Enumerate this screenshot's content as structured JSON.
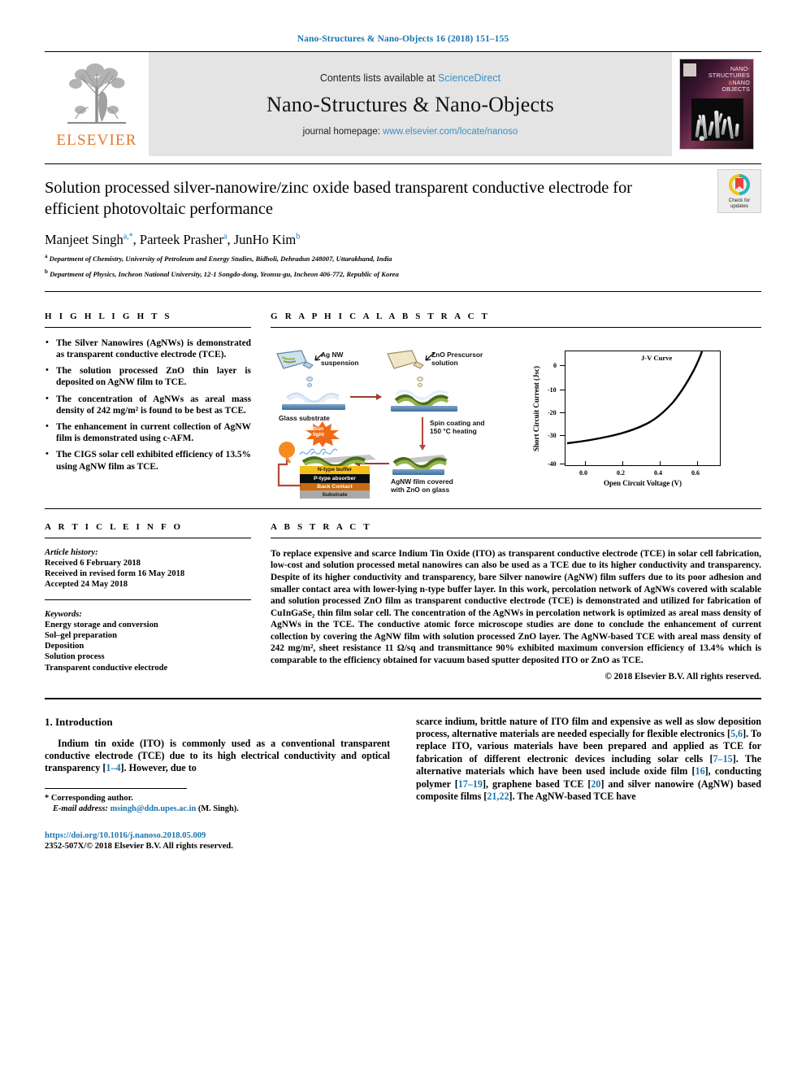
{
  "running_head": "Nano-Structures & Nano-Objects 16 (2018) 151–155",
  "masthead": {
    "contents_prefix": "Contents lists available at ",
    "sciencedirect": "ScienceDirect",
    "journal_name": "Nano-Structures & Nano-Objects",
    "homepage_prefix": "journal homepage: ",
    "homepage_url": "www.elsevier.com/locate/nanoso",
    "publisher": "ELSEVIER",
    "cover_title_line1": "NANO-",
    "cover_title_line2": "STRUCTURES",
    "cover_title_line3": "NANO",
    "cover_title_line4": "OBJECTS",
    "cover_amp": "&"
  },
  "article": {
    "title": "Solution processed silver-nanowire/zinc oxide based transparent conductive electrode for efficient photovoltaic performance",
    "authors": [
      {
        "name": "Manjeet Singh",
        "marks": "a,*"
      },
      {
        "name": "Parteek Prasher",
        "marks": "a"
      },
      {
        "name": "JunHo Kim",
        "marks": "b"
      }
    ],
    "affiliations": [
      {
        "mark": "a",
        "text": "Department of Chemistry, University of Petroleum and Energy Studies, Bidholi, Dehradun 248007, Uttarakhand, India"
      },
      {
        "mark": "b",
        "text": "Department of Physics, Incheon National University, 12-1 Songdo-dong, Yeonsu-gu, Incheon 406-772, Republic of Korea"
      }
    ],
    "crossmark": {
      "line1": "Check for",
      "line2": "updates"
    }
  },
  "highlights": {
    "heading": "H I G H L I G H T S",
    "items": [
      "The Silver Nanowires (AgNWs) is demonstrated as transparent conductive electrode (TCE).",
      "The solution processed ZnO thin layer is deposited on AgNW film to TCE.",
      "The concentration of AgNWs as areal mass density of 242 mg/m² is found to be best as TCE.",
      "The enhancement in current collection of AgNW film is demonstrated using c-AFM.",
      "The CIGS solar cell exhibited efficiency of 13.5% using AgNW film as TCE."
    ]
  },
  "graphical_abstract": {
    "heading": "G R A P H I C A L   A B S T R A C T",
    "labels": {
      "ag_nw": "Ag NW\nsuspension",
      "zno_precursor": "ZnO Prescursor\nsolution",
      "glass_substrate": "Glass substrate",
      "spin_coating": "Spin coating and\n150 °C heating",
      "agnw_film": "AgNW film covered\nwith ZnO on glass",
      "sun_light": "Sun\nlight"
    },
    "solar_stack": [
      "N-type buffer",
      "P-type absorber",
      "Back Contact",
      "Substrate"
    ]
  },
  "chart_data": {
    "type": "line",
    "title": "J-V Curve",
    "xlabel": "Open Circuit Voltage (V)",
    "ylabel": "Short Circuit Current (Jsc)",
    "xlim": [
      -0.07,
      0.7
    ],
    "ylim": [
      -40,
      6
    ],
    "xticks": [
      "0.0",
      "0.2",
      "0.4",
      "0.6"
    ],
    "xtick_values": [
      0.0,
      0.2,
      0.4,
      0.6
    ],
    "yticks": [
      "0",
      "-10",
      "-20",
      "-30",
      "-40"
    ],
    "ytick_values": [
      0,
      -10,
      -20,
      -30,
      -40
    ],
    "grid": false,
    "series": [
      {
        "name": "J-V Curve",
        "x": [
          -0.05,
          0.0,
          0.05,
          0.1,
          0.15,
          0.2,
          0.25,
          0.3,
          0.35,
          0.4,
          0.45,
          0.5,
          0.55,
          0.58,
          0.6,
          0.62,
          0.635,
          0.645
        ],
        "y": [
          -32.2,
          -31.7,
          -31.2,
          -30.6,
          -30.0,
          -29.2,
          -28.3,
          -27.2,
          -25.8,
          -24.0,
          -21.6,
          -18.2,
          -13.2,
          -9.3,
          -6.0,
          -1.5,
          2.5,
          6.0
        ]
      }
    ]
  },
  "article_info": {
    "heading": "A R T I C L E   I N F O",
    "history_label": "Article history:",
    "history": [
      "Received 6 February 2018",
      "Received in revised form 16 May 2018",
      "Accepted 24 May 2018"
    ],
    "keywords_label": "Keywords:",
    "keywords": [
      "Energy storage and conversion",
      "Sol–gel preparation",
      "Deposition",
      "Solution process",
      "Transparent conductive electrode"
    ]
  },
  "abstract": {
    "heading": "A B S T R A C T",
    "text": "To replace expensive and scarce Indium Tin Oxide (ITO) as transparent conductive electrode (TCE) in solar cell fabrication, low-cost and solution processed metal nanowires can also be used as a TCE due to its higher conductivity and transparency. Despite of its higher conductivity and transparency, bare Silver nanowire (AgNW) film suffers due to its poor adhesion and smaller contact area with lower-lying n-type buffer layer. In this work, percolation network of AgNWs covered with scalable and solution processed ZnO film as transparent conductive electrode (TCE) is demonstrated and utilized for fabrication of CuInGaSe₂ thin film solar cell. The concentration of the AgNWs in percolation network is optimized as areal mass density of AgNWs in the TCE. The conductive atomic force microscope studies are done to conclude the enhancement of current collection by covering the AgNW film with solution processed ZnO layer. The AgNW-based TCE with areal mass density of 242 mg/m², sheet resistance 11 Ω/sq and transmittance 90% exhibited maximum conversion efficiency of 13.4% which is comparable to the efficiency obtained for vacuum based sputter deposited ITO or ZnO as TCE.",
    "copyright": "© 2018 Elsevier B.V. All rights reserved."
  },
  "body": {
    "section_number": "1.",
    "section_title": "Introduction",
    "left_paragraph": "Indium tin oxide (ITO) is commonly used as a conventional transparent conductive electrode (TCE) due to its high electrical conductivity and optical transparency [1–4]. However, due to",
    "right_paragraph": "scarce indium, brittle nature of ITO film and expensive as well as slow deposition process, alternative materials are needed especially for flexible electronics [5,6]. To replace ITO, various materials have been prepared and applied as TCE for fabrication of different electronic devices including solar cells [7–15]. The alternative materials which have been used include oxide film [16], conducting polymer [17–19], graphene based TCE [20] and silver nanowire (AgNW) based composite films [21,22]. The AgNW-based TCE have"
  },
  "footer": {
    "corresponding_mark": "*",
    "corresponding_label": "Corresponding author.",
    "email_label": "E-mail address:",
    "email": "msingh@ddn.upes.ac.in",
    "email_suffix": "(M. Singh).",
    "doi": "https://doi.org/10.1016/j.nanoso.2018.05.009",
    "issn_line": "2352-507X/© 2018 Elsevier B.V. All rights reserved."
  },
  "colors": {
    "link": "#1a75b0",
    "elsevier_orange": "#e87722",
    "mast_bg": "#e4e4e4"
  }
}
